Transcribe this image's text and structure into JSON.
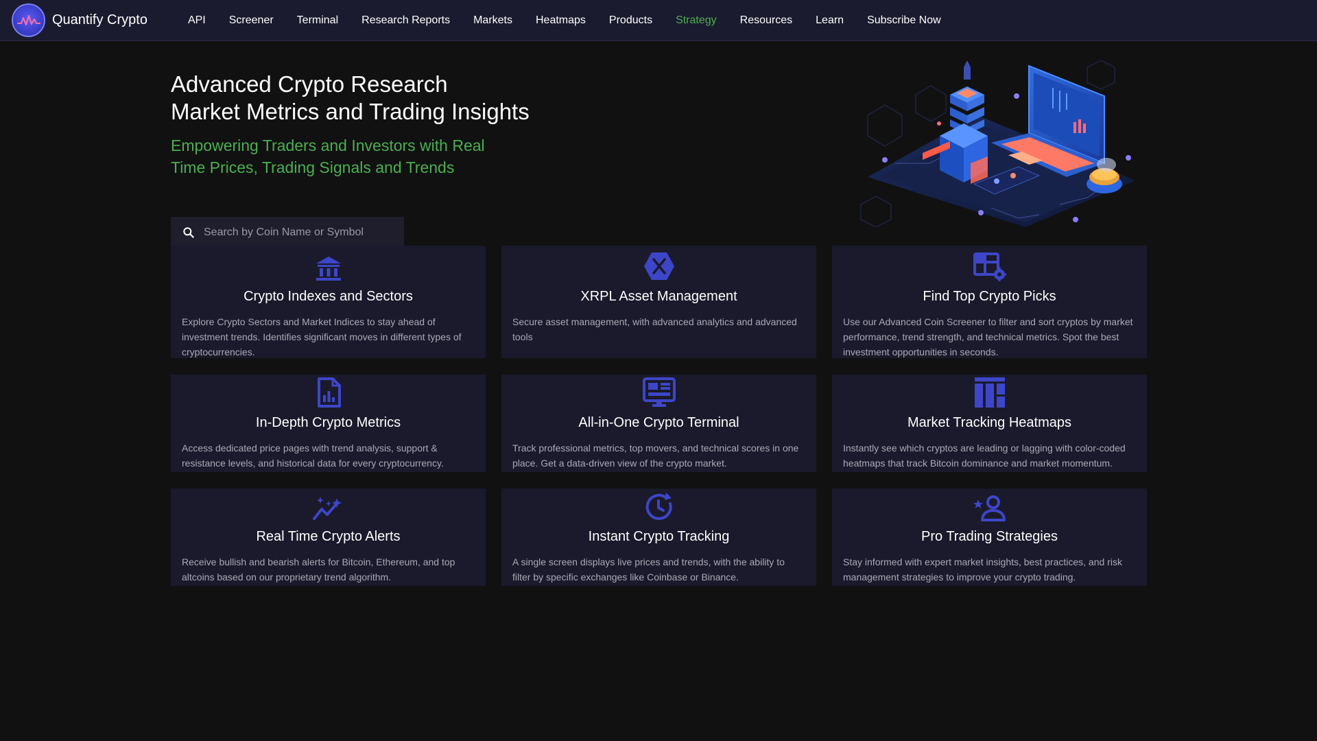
{
  "brand": {
    "name": "Quantify Crypto"
  },
  "nav": {
    "items": [
      {
        "label": "API"
      },
      {
        "label": "Screener"
      },
      {
        "label": "Terminal"
      },
      {
        "label": "Research Reports"
      },
      {
        "label": "Markets"
      },
      {
        "label": "Heatmaps"
      },
      {
        "label": "Products"
      },
      {
        "label": "Strategy"
      },
      {
        "label": "Resources"
      },
      {
        "label": "Learn"
      },
      {
        "label": "Subscribe Now"
      }
    ],
    "active": "Strategy"
  },
  "hero": {
    "title_line1": "Advanced Crypto Research",
    "title_line2": "Market Metrics and Trading Insights",
    "subtitle": "Empowering Traders and Investors with Real Time Prices, Trading Signals and Trends"
  },
  "search": {
    "placeholder": "Search by Coin Name or Symbol"
  },
  "cards": [
    {
      "icon": "bank-icon",
      "title": "Crypto Indexes and Sectors",
      "description": "Explore Crypto Sectors and Market Indices to stay ahead of investment trends. Identifies significant moves in different types of cryptocurrencies."
    },
    {
      "icon": "xrpl-hexagon-icon",
      "title": "XRPL Asset Management",
      "description": "Secure asset management, with advanced analytics and advanced tools"
    },
    {
      "icon": "table-gear-icon",
      "title": "Find Top Crypto Picks",
      "description": "Use our Advanced Coin Screener to filter and sort cryptos by market performance, trend strength, and technical metrics. Spot the best investment opportunities in seconds."
    },
    {
      "icon": "report-chart-icon",
      "title": "In-Depth Crypto Metrics",
      "description": "Access dedicated price pages with trend analysis, support & resistance levels, and historical data for every cryptocurrency."
    },
    {
      "icon": "monitor-dashboard-icon",
      "title": "All-in-One Crypto Terminal",
      "description": "Track professional metrics, top movers, and technical scores in one place. Get a data-driven view of the crypto market."
    },
    {
      "icon": "heatmap-columns-icon",
      "title": "Market Tracking Heatmaps",
      "description": "Instantly see which cryptos are leading or lagging with color-coded heatmaps that track Bitcoin dominance and market momentum."
    },
    {
      "icon": "sparkle-trend-icon",
      "title": "Real Time Crypto Alerts",
      "description": "Receive bullish and bearish alerts for Bitcoin, Ethereum, and top altcoins based on our proprietary trend algorithm."
    },
    {
      "icon": "clock-refresh-icon",
      "title": "Instant Crypto Tracking",
      "description": "A single screen displays live prices and trends, with the ability to filter by specific exchanges like Coinbase or Binance."
    },
    {
      "icon": "person-star-icon",
      "title": "Pro Trading Strategies",
      "description": "Stay informed with expert market insights, best practices, and risk management strategies to improve your crypto trading."
    }
  ],
  "colors": {
    "background": "#111112",
    "nav_background": "#1b1b2f",
    "card_background": "#1a1a2c",
    "accent_green": "#4caf50",
    "icon_blue": "#3d46c8"
  }
}
